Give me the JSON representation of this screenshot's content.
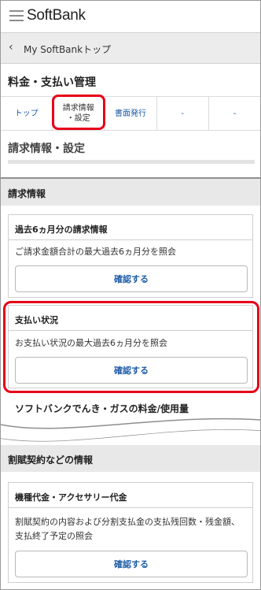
{
  "header": {
    "logo": "SoftBank"
  },
  "backbar": {
    "label": "My SoftBankトップ"
  },
  "management": {
    "title": "料金・支払い管理"
  },
  "tabs": [
    {
      "line1": "トップ",
      "line2": ""
    },
    {
      "line1": "請求情報",
      "line2": "・設定"
    },
    {
      "line1": "書面発行",
      "line2": ""
    },
    {
      "line1": "-",
      "line2": ""
    },
    {
      "line1": "-",
      "line2": ""
    }
  ],
  "page": {
    "section_title": "請求情報・設定"
  },
  "billing_group": {
    "title": "請求情報",
    "past6": {
      "title": "過去6ヵ月分の請求情報",
      "desc": "ご請求金額合計の最大過去6ヵ月分を照会",
      "button": "確認する"
    },
    "payment": {
      "title": "支払い状況",
      "desc": "お支払い状況の最大過去6ヵ月分を照会",
      "button": "確認する"
    },
    "next_cut_title": "ソフトバンクでんき・ガスの料金/使用量"
  },
  "installment_group": {
    "title": "割賦契約などの情報",
    "device": {
      "title": "機種代金・アクセサリー代金",
      "desc": "割賦契約の内容および分割支払金の支払残回数・残金額、支払終了予定の照会",
      "button": "確認する"
    }
  },
  "colors": {
    "accent_red": "#e6001a",
    "link_blue": "#1e5ca8"
  }
}
